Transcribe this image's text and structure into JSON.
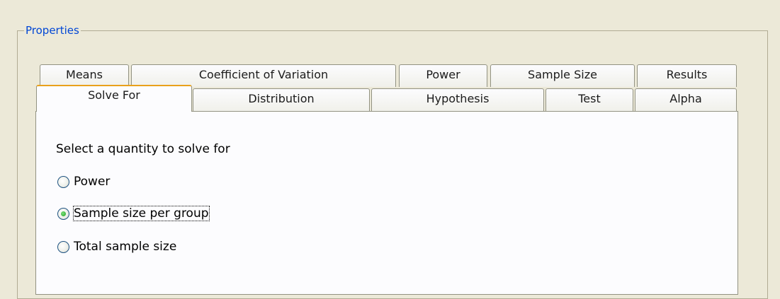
{
  "group": {
    "title": "Properties"
  },
  "tabs_row1": [
    "Means",
    "Coefficient of Variation",
    "Power",
    "Sample Size",
    "Results"
  ],
  "tabs_row2": [
    "Solve For",
    "Distribution",
    "Hypothesis",
    "Test",
    "Alpha"
  ],
  "active_tab": "Solve For",
  "panel": {
    "prompt": "Select a quantity to solve for",
    "options": [
      {
        "label": "Power",
        "checked": false
      },
      {
        "label": "Sample size per group",
        "checked": true
      },
      {
        "label": "Total sample size",
        "checked": false
      }
    ]
  },
  "colors": {
    "legend_text": "#0046d5",
    "active_tab_accent": "#e9a11b",
    "background": "#ece9d8"
  }
}
